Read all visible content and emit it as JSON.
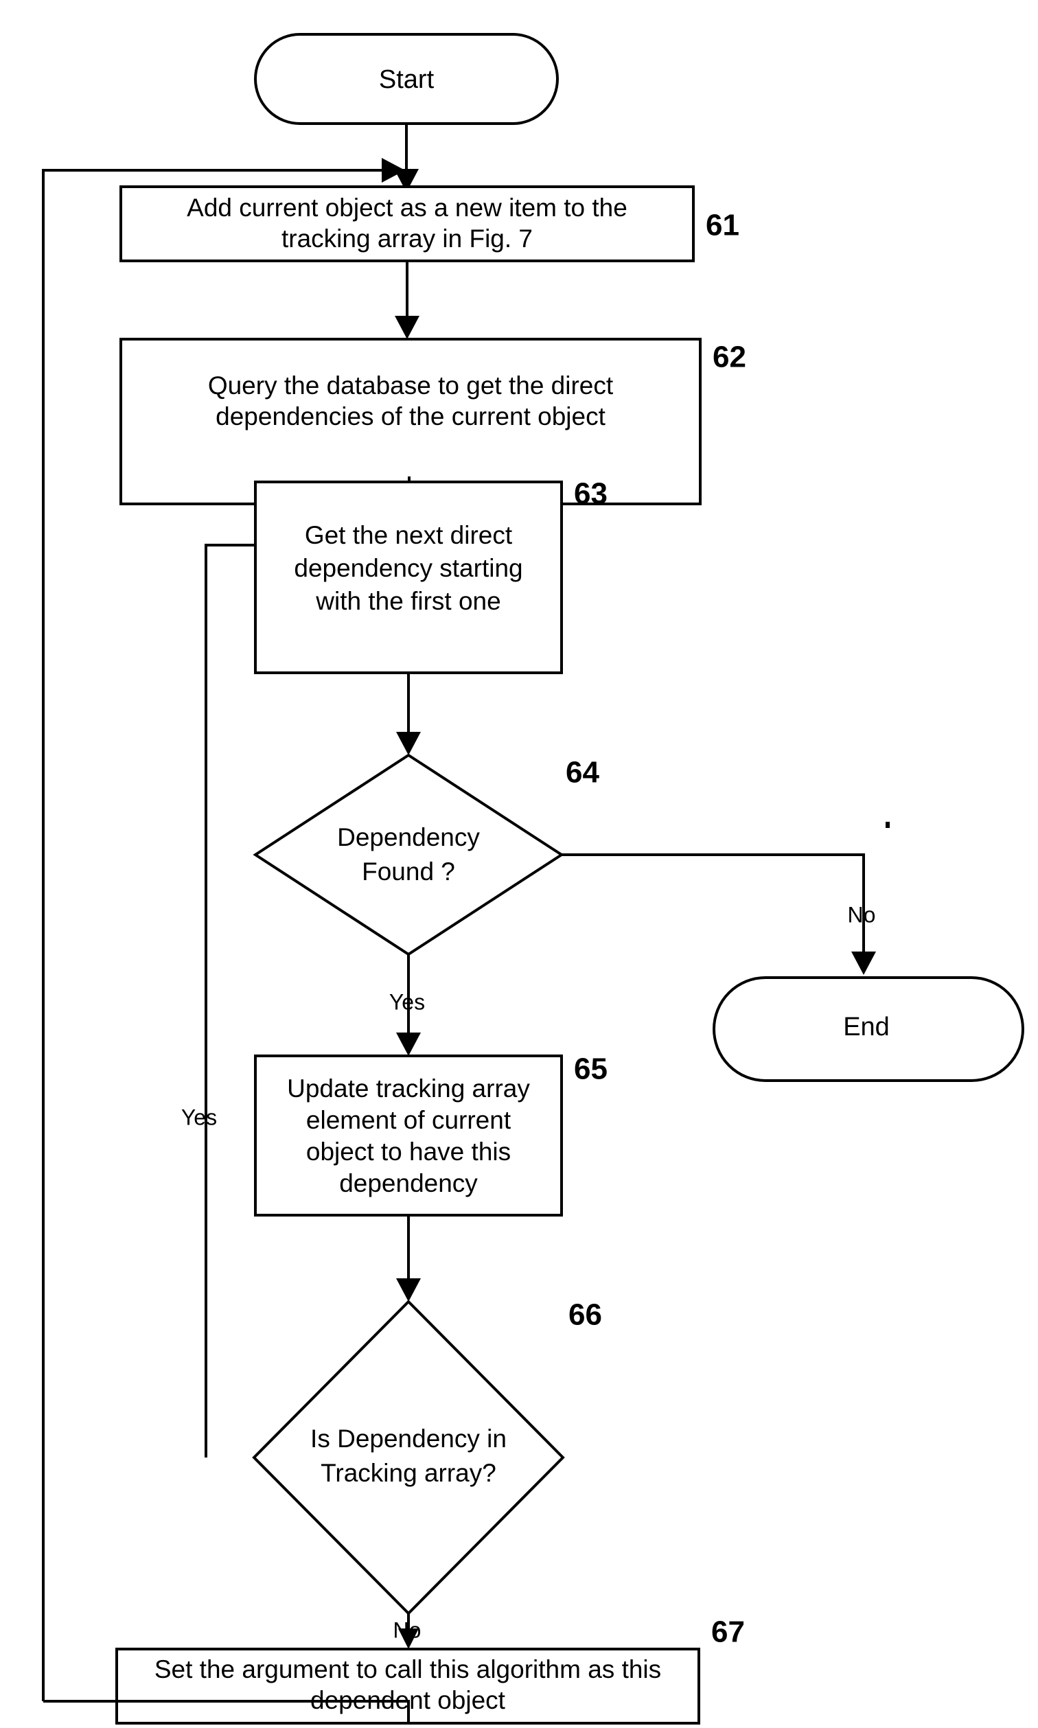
{
  "figure": {
    "type": "flowchart",
    "title": "",
    "orientation": "top-to-bottom"
  },
  "nodes": {
    "start": {
      "shape": "terminator",
      "label": "Start"
    },
    "end": {
      "shape": "terminator",
      "label": "End"
    },
    "step61": {
      "shape": "process",
      "ref": "61",
      "line1": "Add current object as a new item to the",
      "line2": "tracking array in Fig. 7"
    },
    "step62": {
      "shape": "process",
      "ref": "62",
      "line1": "Query the database to get the direct",
      "line2": "dependencies of the current object"
    },
    "step63": {
      "shape": "process",
      "ref": "63",
      "line1": "Get the next direct",
      "line2": "dependency starting",
      "line3": "with the first one"
    },
    "step64": {
      "shape": "decision",
      "ref": "64",
      "line1": "Dependency",
      "line2": "Found ?"
    },
    "step65": {
      "shape": "process",
      "ref": "65",
      "line1": "Update tracking array",
      "line2": "element of current",
      "line3": "object to have this",
      "line4": "dependency"
    },
    "step66": {
      "shape": "decision",
      "ref": "66",
      "line1": "Is Dependency in",
      "line2": "Tracking array?"
    },
    "step67": {
      "shape": "process",
      "ref": "67",
      "line1": "Set the argument to call this algorithm as this",
      "line2": "dependent object"
    }
  },
  "edge_labels": {
    "d64_no": "No",
    "d64_yes": "Yes",
    "d66_yes": "Yes",
    "d66_no": "No"
  },
  "colors": {
    "stroke": "#000000",
    "fill": "#ffffff",
    "background": "#ffffff"
  }
}
